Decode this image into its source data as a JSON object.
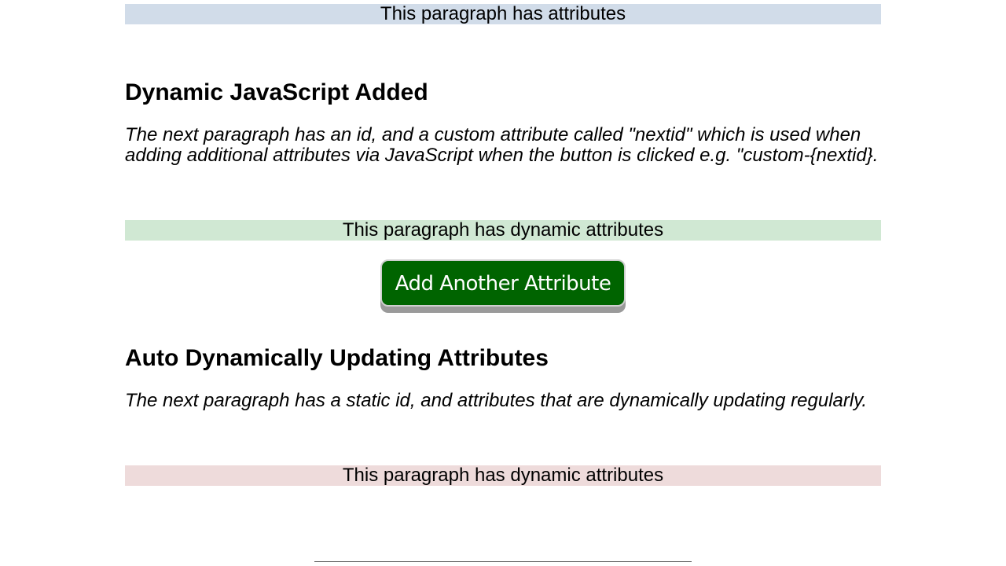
{
  "static_section": {
    "paragraph": "This paragraph has attributes"
  },
  "dynamic_section": {
    "heading": "Dynamic JavaScript Added",
    "description": "The next paragraph has an id, and a custom attribute called \"nextid\" which is used when adding additional attributes via JavaScript when the button is clicked e.g. \"custom-{nextid}.",
    "paragraph": "This paragraph has dynamic attributes",
    "button_label": "Add Another Attribute"
  },
  "auto_section": {
    "heading": "Auto Dynamically Updating Attributes",
    "description": "The next paragraph has a static id, and attributes that are dynamically updating regularly.",
    "paragraph": "This paragraph has dynamic attributes"
  },
  "colors": {
    "static_para_bg": "#d1dce9",
    "dynamic_para_bg": "#d0e8d3",
    "auto_para_bg": "#eedbdb",
    "button_bg": "#006400"
  }
}
